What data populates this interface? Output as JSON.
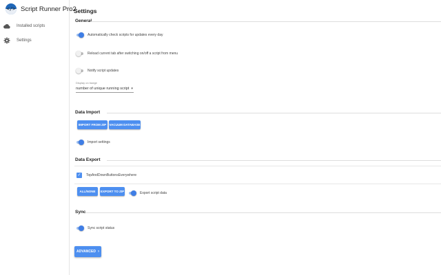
{
  "app": {
    "name": "Script Runner Pro2",
    "logo_glyph": "</>"
  },
  "sidebar": {
    "items": [
      {
        "icon": "cloud-icon",
        "label": "Installed scripts"
      },
      {
        "icon": "gear-icon",
        "label": "Settings"
      }
    ]
  },
  "page": {
    "title": "Settings"
  },
  "sections": {
    "general": {
      "title": "General",
      "settings": [
        {
          "label": "Automatically check scripts for updates every day",
          "on": true
        },
        {
          "label": "Reload current tab after switching on/off a script from menu",
          "on": false
        },
        {
          "label": "Notify script updates",
          "on": false
        }
      ],
      "badge_field": {
        "label": "Display on badge",
        "value": "number of unique running script"
      }
    },
    "data_import": {
      "title": "Data Import",
      "buttons": {
        "import": "IMPORT FROM ZIP",
        "vacuum": "VACUUM DATABASE"
      },
      "setting": {
        "label": "Import settings",
        "on": true
      }
    },
    "data_export": {
      "title": "Data Export",
      "item": {
        "label": "TopAndDownButtonsEverywhere",
        "checked": true
      },
      "buttons": {
        "all_none": "ALL/NONE",
        "export": "EXPORT TO ZIP"
      },
      "setting": {
        "label": "Export script data",
        "on": true
      }
    },
    "sync": {
      "title": "Sync",
      "setting": {
        "label": "Sync script status",
        "on": true
      }
    }
  },
  "advanced_button": {
    "label": "ADVANCED"
  },
  "colors": {
    "accent": "#4d8ff0",
    "toggle_on": "#3f7ee6",
    "logo": "#1f67b8"
  }
}
